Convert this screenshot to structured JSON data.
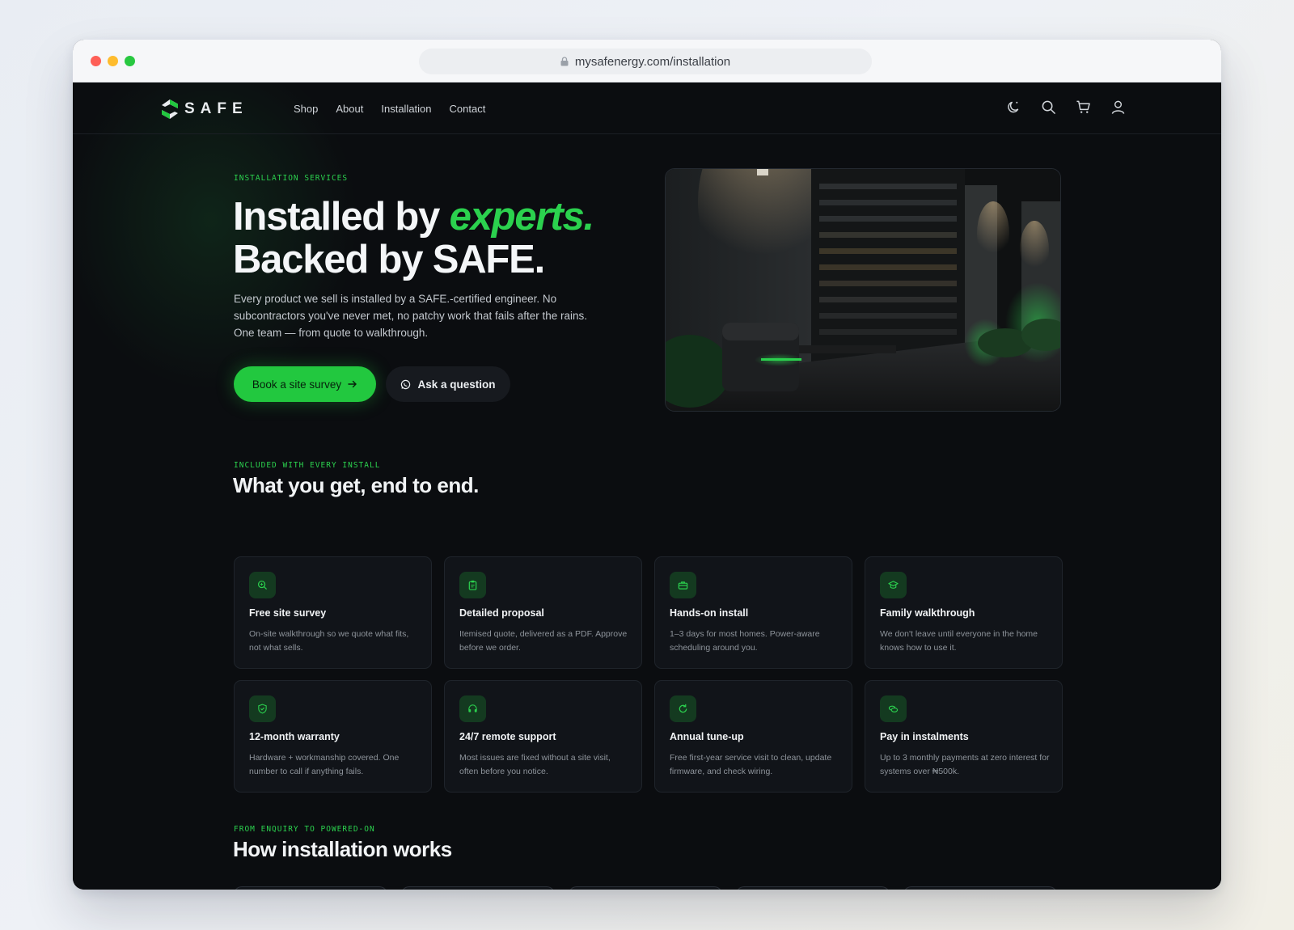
{
  "browser": {
    "url": "mysafenergy.com/installation"
  },
  "nav": {
    "logo_text": "SAFE",
    "links": [
      "Shop",
      "About",
      "Installation",
      "Contact"
    ],
    "icons": [
      "theme-toggle-icon",
      "search-icon",
      "cart-icon",
      "account-icon"
    ]
  },
  "hero": {
    "eyebrow": "INSTALLATION SERVICES",
    "title_part1": "Installed by ",
    "title_accent": "experts.",
    "title_line2": "Backed by SAFE.",
    "text": "Every product we sell is installed by a SAFE.-certified engineer. No subcontractors you've never met, no patchy work that fails after the rains. One team — from quote to walkthrough.",
    "primary_cta": "Book a site survey",
    "secondary_cta": "Ask a question"
  },
  "included": {
    "eyebrow": "INCLUDED WITH EVERY INSTALL",
    "title": "What you get, end to end.",
    "cards": [
      {
        "title": "Free site survey",
        "desc": "On-site walkthrough so we quote what fits, not what sells.",
        "icon": "magnify-icon"
      },
      {
        "title": "Detailed proposal",
        "desc": "Itemised quote, delivered as a PDF. Approve before we order.",
        "icon": "clipboard-icon"
      },
      {
        "title": "Hands-on install",
        "desc": "1–3 days for most homes. Power-aware scheduling around you.",
        "icon": "toolbox-icon"
      },
      {
        "title": "Family walkthrough",
        "desc": "We don't leave until everyone in the home knows how to use it.",
        "icon": "graduation-cap-icon"
      },
      {
        "title": "12-month warranty",
        "desc": "Hardware + workmanship covered. One number to call if anything fails.",
        "icon": "shield-icon"
      },
      {
        "title": "24/7 remote support",
        "desc": "Most issues are fixed without a site visit, often before you notice.",
        "icon": "headset-icon"
      },
      {
        "title": "Annual tune-up",
        "desc": "Free first-year service visit to clean, update firmware, and check wiring.",
        "icon": "refresh-icon"
      },
      {
        "title": "Pay in instalments",
        "desc": "Up to 3 monthly payments at zero interest for systems over ₦500k.",
        "icon": "coins-icon"
      }
    ]
  },
  "process": {
    "eyebrow": "FROM ENQUIRY TO POWERED-ON",
    "title": "How installation works"
  },
  "colors": {
    "accent": "#22c83f",
    "background": "#0b0d10",
    "card": "#111419"
  }
}
